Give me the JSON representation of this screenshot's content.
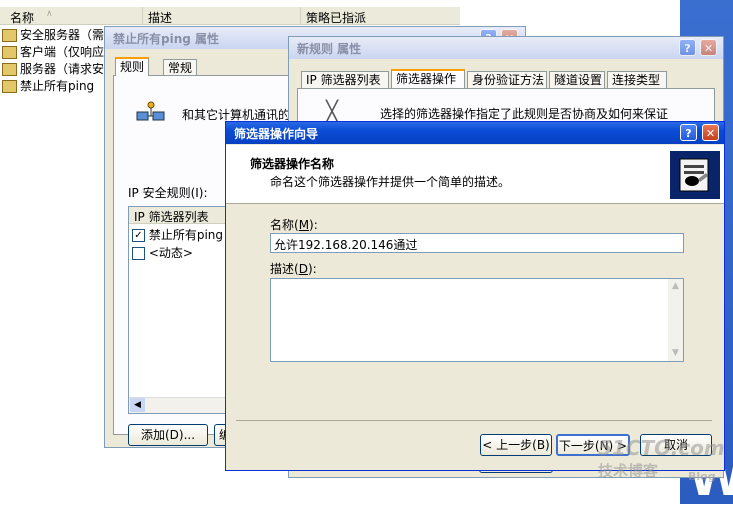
{
  "explorer": {
    "columns": [
      "名称",
      "描述",
      "策略已指派"
    ],
    "items": [
      "安全服务器（需",
      "客户端（仅响应",
      "服务器（请求安",
      "禁止所有ping"
    ]
  },
  "ping_dialog": {
    "title": "禁止所有ping 属性",
    "tabs": [
      "规则",
      "常规"
    ],
    "description": "和其它计算机通讯的",
    "rules_label": "IP 安全规则(I):",
    "list_header": "IP 筛选器列表",
    "rules": [
      {
        "label": "禁止所有ping",
        "checked": true
      },
      {
        "label": "<动态>",
        "checked": false
      }
    ],
    "add_button": "添加(D)...",
    "edit_button_partial": "编"
  },
  "rule_dialog": {
    "title": "新规则 属性",
    "tabs": [
      "IP 筛选器列表",
      "筛选器操作",
      "身份验证方法",
      "隧道设置",
      "连接类型"
    ],
    "selected_tab": "筛选器操作",
    "description_partial": "选择的筛选器操作指定了此规则是否协商及如何来保证"
  },
  "wizard": {
    "title": "筛选器操作向导",
    "header_title": "筛选器操作名称",
    "header_subtitle": "命名这个筛选器操作并提供一个简单的描述。",
    "name_label": "名称(M):",
    "name_value": "允许192.168.20.146通过",
    "desc_label": "描述(D):",
    "desc_value": "",
    "back_button": "< 上一步(B)",
    "next_button": "下一步(N) >",
    "cancel_button": "取消"
  },
  "watermark": {
    "line1": "51CTO.com",
    "line2": "技术博客",
    "line3": "Blog"
  },
  "colors": {
    "xp_blue": "#0a4bd6",
    "desktop": "#2f62c4",
    "dialog_face": "#ece9d8"
  }
}
